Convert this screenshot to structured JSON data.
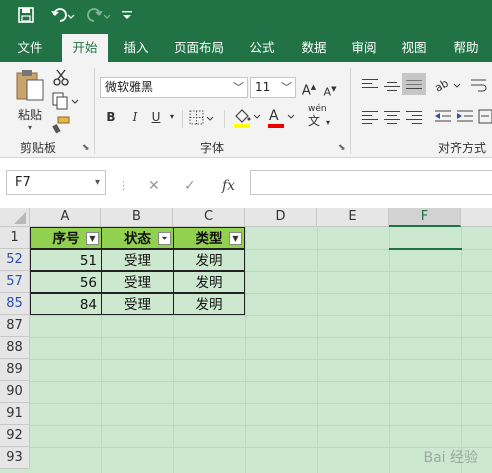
{
  "colors": {
    "accent": "#217346",
    "header_fill": "#92d050",
    "sheet_bg": "#cce8cf",
    "filtered_row_number": "#2b4fb3"
  },
  "quick_access": {
    "save_icon": "save-icon",
    "undo_icon": "undo-icon",
    "redo_icon": "redo-icon",
    "customize_icon": "chevron-down-icon"
  },
  "tabs": [
    "文件",
    "开始",
    "插入",
    "页面布局",
    "公式",
    "数据",
    "审阅",
    "视图",
    "帮助"
  ],
  "active_tab": "开始",
  "ribbon": {
    "clipboard": {
      "paste_label": "粘贴",
      "group_label": "剪贴板"
    },
    "font": {
      "font_name": "微软雅黑",
      "font_size": "11",
      "group_label": "字体",
      "bold": "B",
      "italic": "I",
      "underline": "U",
      "grow": "A",
      "shrink": "A",
      "phonetic": "wén"
    },
    "alignment": {
      "group_label": "对齐方式"
    }
  },
  "formula_bar": {
    "name_box": "F7",
    "cancel": "✕",
    "enter": "✓",
    "fx": "fx",
    "formula": ""
  },
  "sheet": {
    "columns": [
      "A",
      "B",
      "C",
      "D",
      "E",
      "F"
    ],
    "selected_column": "F",
    "row_numbers": [
      "1",
      "52",
      "57",
      "85",
      "87",
      "88",
      "89",
      "90",
      "91",
      "92",
      "93"
    ],
    "header": [
      "序号",
      "状态",
      "类型"
    ],
    "rows": [
      {
        "num": "51",
        "status": "受理",
        "type": "发明"
      },
      {
        "num": "56",
        "status": "受理",
        "type": "发明"
      },
      {
        "num": "84",
        "status": "受理",
        "type": "发明"
      }
    ],
    "active_cell": "F7"
  },
  "watermark": "Bai 经验"
}
